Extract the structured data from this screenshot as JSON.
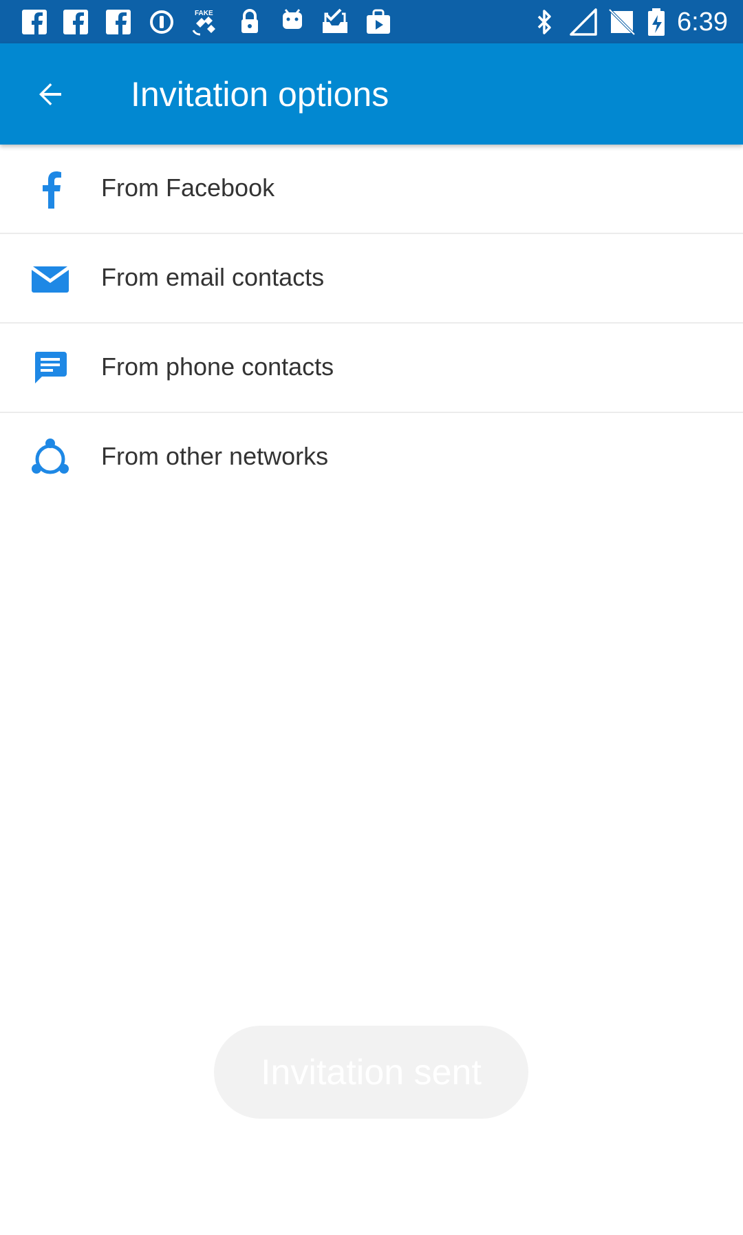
{
  "status_bar": {
    "time": "6:39",
    "left_icons": [
      "facebook-notification-icon",
      "facebook-notification-icon",
      "facebook-notification-icon",
      "circle-info-icon",
      "fake-gps-satellite-icon",
      "lock-icon",
      "android-icon",
      "inbox-check-icon",
      "play-store-bag-icon"
    ],
    "right_icons": [
      "bluetooth-icon",
      "signal-icon",
      "no-sim-icon",
      "battery-charging-icon"
    ]
  },
  "app_bar": {
    "title": "Invitation options",
    "back_icon": "arrow-back-icon"
  },
  "options": [
    {
      "label": "From Facebook",
      "icon": "facebook-icon"
    },
    {
      "label": "From email contacts",
      "icon": "email-icon"
    },
    {
      "label": "From phone contacts",
      "icon": "message-icon"
    },
    {
      "label": "From other networks",
      "icon": "share-network-icon"
    }
  ],
  "toast": {
    "text": "Invitation sent"
  },
  "colors": {
    "status_bar": "#0d61a8",
    "app_bar": "#0288d1",
    "icon_blue": "#1e88e5",
    "toast_bg": "#f2f2f2"
  }
}
